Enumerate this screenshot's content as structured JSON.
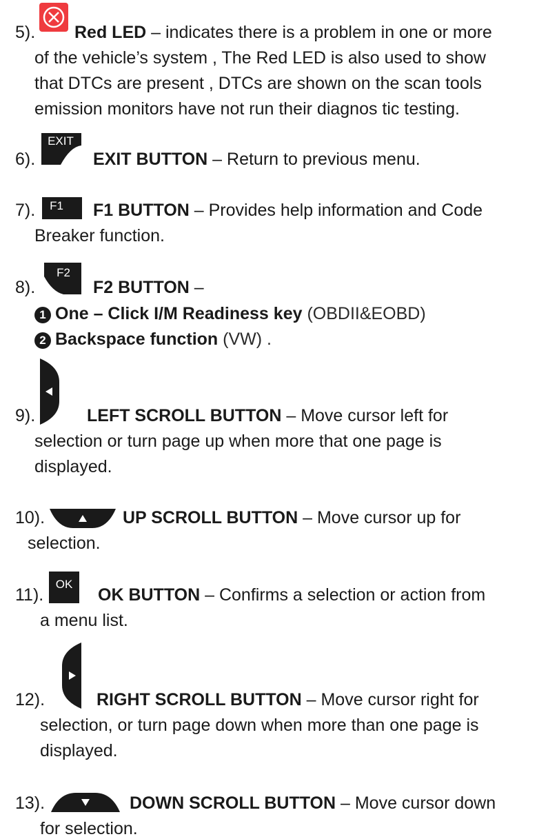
{
  "items": [
    {
      "number": "5).",
      "title": "Red LED",
      "icon": "red-led-x-icon",
      "lines": [
        " – indicates there is a problem in one or more",
        "of the vehicle’s system , The Red LED is also used to show",
        "that DTCs are present , DTCs are shown on the scan tools",
        "emission monitors have not run their diagnos tic testing."
      ]
    },
    {
      "number": "6).",
      "key_label": "EXIT",
      "title": "EXIT BUTTON",
      "lines": [
        " – Return to previous menu."
      ]
    },
    {
      "number": "7).",
      "key_label": "F1",
      "title": "F1 BUTTON",
      "lines": [
        " – Provides help information and Code",
        "Breaker function."
      ]
    },
    {
      "number": "8).",
      "key_label": "F2",
      "title": "F2 BUTTON",
      "lines": [
        " –"
      ],
      "sub_items": [
        {
          "badge": "1",
          "title": "One – Click I/M Readiness key",
          "note": " (OBDII&EOBD)"
        },
        {
          "badge": "2",
          "title": "Backspace function",
          "note": " (VW) ."
        }
      ]
    },
    {
      "number": "9).",
      "title": "LEFT SCROLL BUTTON",
      "icon": "left-arrow-key-icon",
      "lines": [
        " – Move cursor left for",
        "selection or turn page up when more that one page is",
        "displayed."
      ]
    },
    {
      "number": "10).",
      "title": "UP SCROLL BUTTON",
      "icon": "up-arrow-key-icon",
      "lines": [
        " – Move cursor up for",
        "selection."
      ]
    },
    {
      "number": "11).",
      "key_label": "OK",
      "title": "OK BUTTON",
      "lines": [
        " – Confirms a selection or action from",
        "a menu list."
      ]
    },
    {
      "number": "12).",
      "title": "RIGHT SCROLL BUTTON",
      "icon": "right-arrow-key-icon",
      "lines": [
        " – Move cursor right for",
        "selection, or turn page down when more than one page is",
        "displayed."
      ]
    },
    {
      "number": "13).",
      "title": "DOWN SCROLL BUTTON",
      "icon": "down-arrow-key-icon",
      "lines": [
        " – Move cursor down",
        "for selection."
      ]
    }
  ],
  "colors": {
    "led_red": "#ef3b3f",
    "key_black": "#1a1a1a",
    "text": "#1a1a1a"
  }
}
